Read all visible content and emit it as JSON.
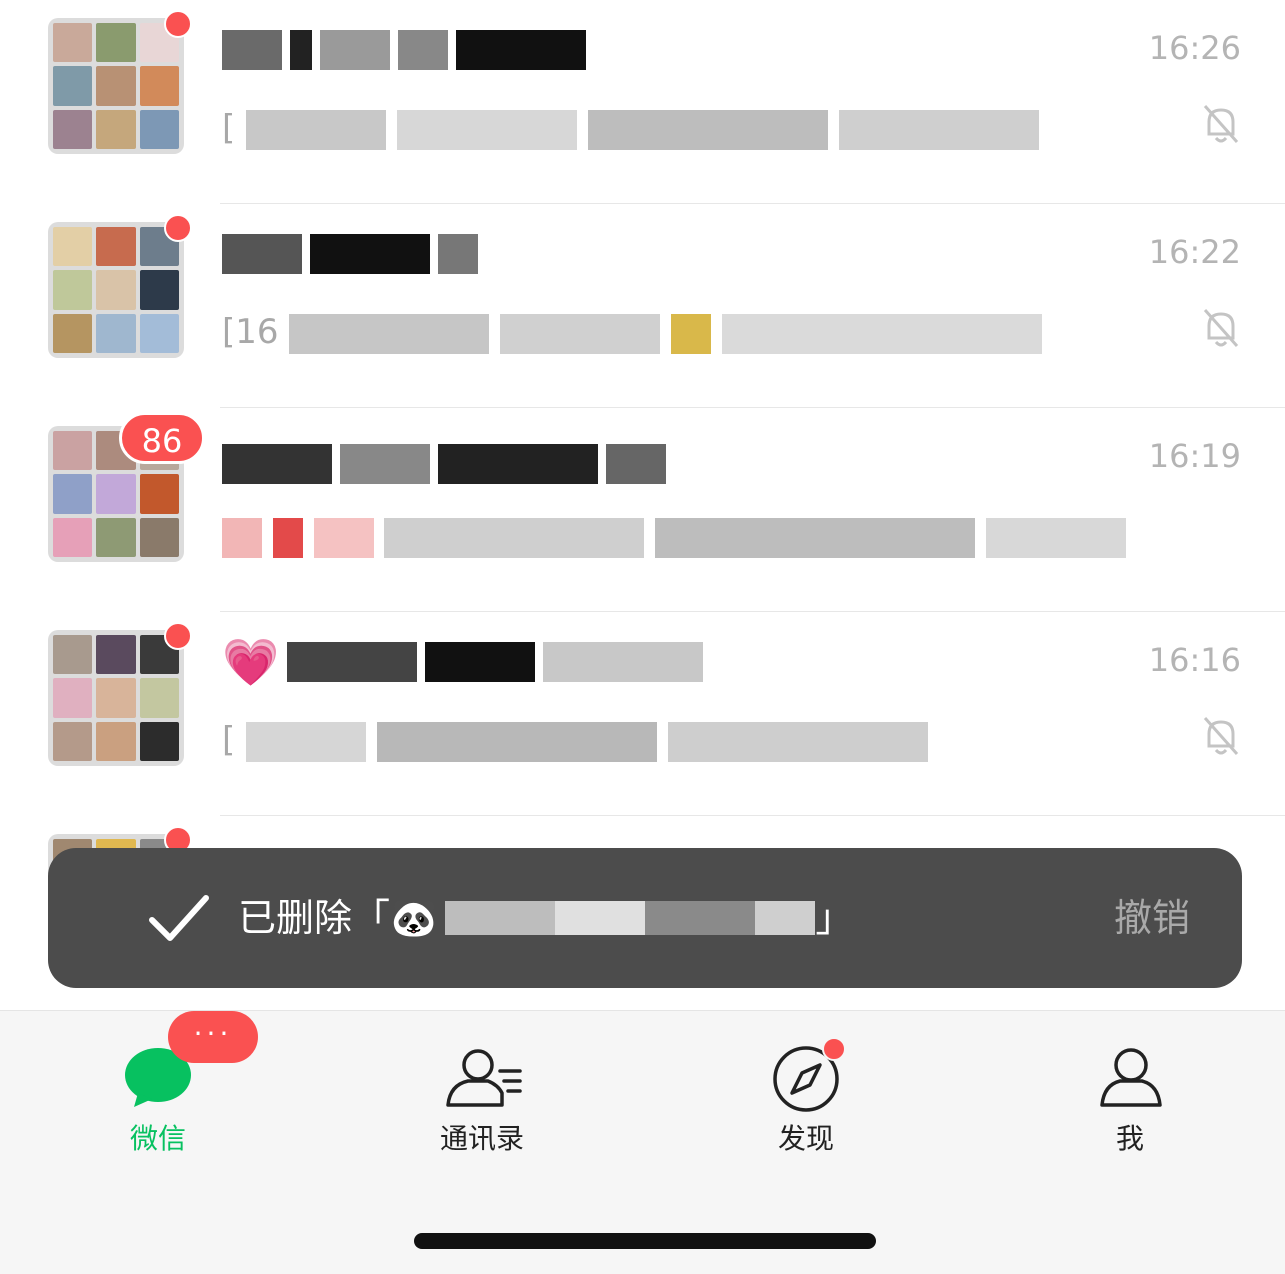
{
  "chats": [
    {
      "time": "16:26",
      "title_visible": "",
      "preview_visible": "[",
      "muted": true,
      "badge": "dot"
    },
    {
      "time": "16:22",
      "title_visible": "",
      "preview_visible": "[16",
      "muted": true,
      "badge": "dot"
    },
    {
      "time": "16:19",
      "title_visible": "",
      "preview_visible": "",
      "muted": false,
      "badge": "86"
    },
    {
      "time": "16:16",
      "title_visible": "💗",
      "preview_visible": "[",
      "muted": true,
      "badge": "dot"
    }
  ],
  "toast": {
    "message_prefix": "已删除「",
    "message_emoji": "🐼",
    "message_suffix": "」",
    "undo_label": "撤销"
  },
  "tabbar": {
    "tabs": [
      {
        "label": "微信",
        "icon": "chat-bubble-icon",
        "active": true,
        "badge": "···"
      },
      {
        "label": "通讯录",
        "icon": "contacts-icon",
        "active": false
      },
      {
        "label": "发现",
        "icon": "compass-icon",
        "active": false,
        "badge": "dot"
      },
      {
        "label": "我",
        "icon": "person-icon",
        "active": false
      }
    ]
  },
  "colors": {
    "accent_green": "#07c160",
    "badge_red": "#fa5151",
    "toast_bg": "#4c4c4c",
    "timestamp_gray": "#b4b4b4"
  }
}
